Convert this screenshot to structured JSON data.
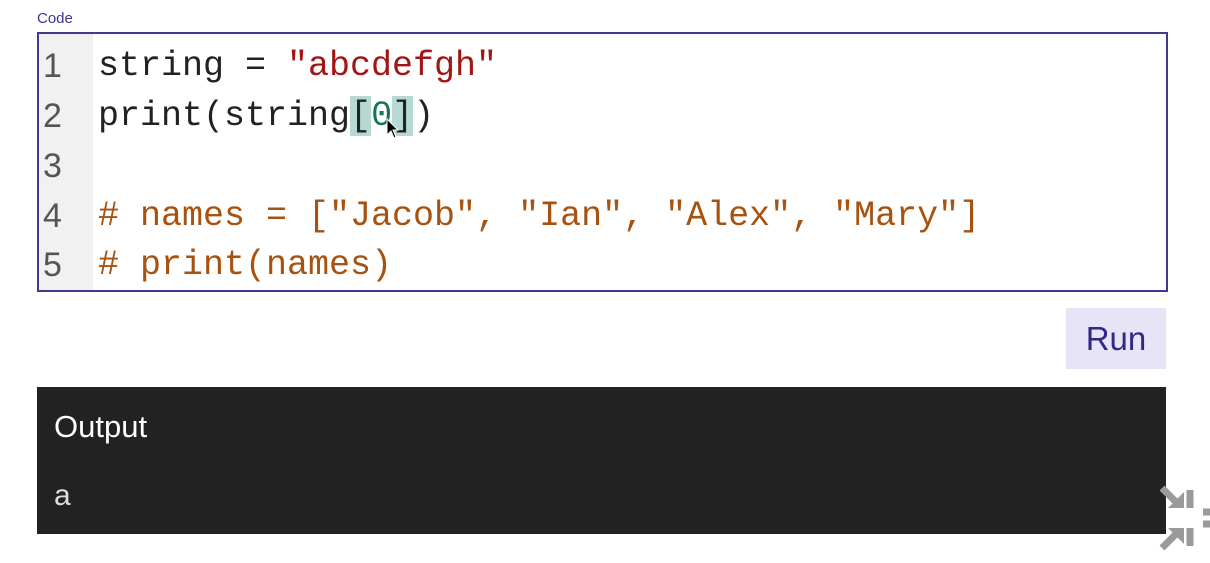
{
  "editor_label": "Code",
  "lines": [
    {
      "n": "1",
      "parts": [
        "string = ",
        "\"abcdefgh\""
      ]
    },
    {
      "n": "2",
      "parts": [
        "print(string",
        "[",
        "0",
        "]",
        ")"
      ]
    },
    {
      "n": "3",
      "parts": []
    },
    {
      "n": "4",
      "parts": [
        "# names = [\"Jacob\", \"Ian\", \"Alex\", \"Mary\"]"
      ]
    },
    {
      "n": "5",
      "parts": [
        "# print(names)"
      ]
    }
  ],
  "run_label": "Run",
  "output": {
    "title": "Output",
    "value": "a"
  }
}
